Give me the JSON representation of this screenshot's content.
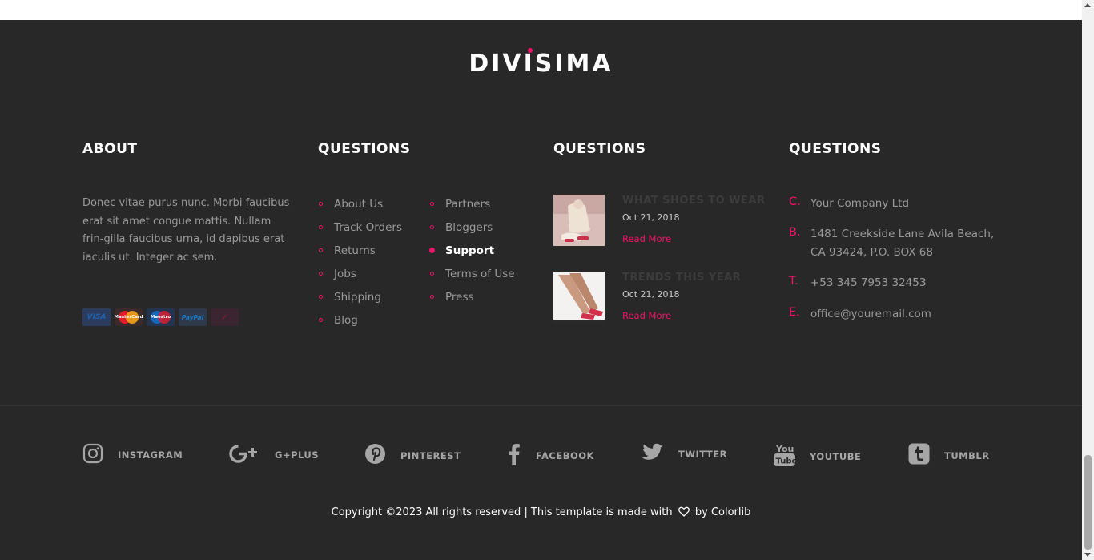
{
  "logo": {
    "text": "DIVISIMA"
  },
  "columns": {
    "about": {
      "title": "ABOUT",
      "text": "Donec vitae purus nunc. Morbi faucibus erat sit amet congue mattis. Nullam frin-gilla faucibus urna, id dapibus erat iaculis ut. Integer ac sem.",
      "payments": [
        "VISA",
        "MasterCard",
        "Maestro",
        "PayPal",
        "VeriSign"
      ]
    },
    "questions_links": {
      "title": "QUESTIONS",
      "list_left": [
        "About Us",
        "Track Orders",
        "Returns",
        "Jobs",
        "Shipping",
        "Blog"
      ],
      "list_right": [
        "Partners",
        "Bloggers",
        "Support",
        "Terms of Use",
        "Press"
      ],
      "active_item": "Support"
    },
    "questions_posts": {
      "title": "QUESTIONS",
      "posts": [
        {
          "title": "WHAT SHOES TO WEAR",
          "date": "Oct 21, 2018",
          "read_more": "Read More"
        },
        {
          "title": "TRENDS THIS YEAR",
          "date": "Oct 21, 2018",
          "read_more": "Read More"
        }
      ]
    },
    "questions_contact": {
      "title": "QUESTIONS",
      "items": [
        {
          "letter": "C.",
          "text": "Your Company Ltd"
        },
        {
          "letter": "B.",
          "text": "1481 Creekside Lane Avila Beach, CA 93424, P.O. BOX 68"
        },
        {
          "letter": "T.",
          "text": "+53 345 7953 32453"
        },
        {
          "letter": "E.",
          "text": "office@youremail.com"
        }
      ]
    }
  },
  "social": [
    {
      "label": "INSTAGRAM",
      "icon": "instagram-icon"
    },
    {
      "label": "G+PLUS",
      "icon": "google-plus-icon"
    },
    {
      "label": "PINTEREST",
      "icon": "pinterest-icon"
    },
    {
      "label": "FACEBOOK",
      "icon": "facebook-icon"
    },
    {
      "label": "TWITTER",
      "icon": "twitter-icon"
    },
    {
      "label": "YOUTUBE",
      "icon": "youtube-icon"
    },
    {
      "label": "TUMBLR",
      "icon": "tumblr-icon"
    }
  ],
  "copyright": {
    "before": "Copyright ©2023 All rights reserved | This template is made with",
    "after": "by",
    "link": "Colorlib"
  },
  "colors": {
    "accent": "#f51167",
    "footer_bg": "#282828"
  }
}
